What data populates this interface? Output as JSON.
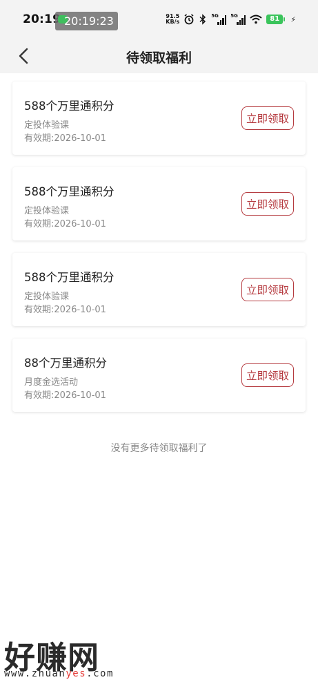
{
  "status_bar": {
    "time": "20:19",
    "overlay_time": "20:19:23",
    "net_speed_value": "91.5",
    "net_speed_unit": "KB/s",
    "signal1_label": "5G",
    "signal2_label": "5G",
    "battery_level": "81",
    "icons": [
      "alarm-icon",
      "bluetooth-icon",
      "signal-icon",
      "wifi-icon",
      "battery-icon",
      "charging-icon"
    ]
  },
  "header": {
    "back_icon": "chevron-left-icon",
    "title": "待领取福利"
  },
  "rewards": [
    {
      "title": "588个万里通积分",
      "desc": "定投体验课",
      "validity": "有效期:2026-10-01",
      "button": "立即领取"
    },
    {
      "title": "588个万里通积分",
      "desc": "定投体验课",
      "validity": "有效期:2026-10-01",
      "button": "立即领取"
    },
    {
      "title": "588个万里通积分",
      "desc": "定投体验课",
      "validity": "有效期:2026-10-01",
      "button": "立即领取"
    },
    {
      "title": "88个万里通积分",
      "desc": "月度金选活动",
      "validity": "有效期:2026-10-01",
      "button": "立即领取"
    }
  ],
  "footer_note": "没有更多待领取福利了",
  "watermark": {
    "text": "好赚网",
    "url_prefix": "www.zhuan",
    "url_highlight": "yes",
    "url_suffix": ".com"
  },
  "colors": {
    "accent": "#b53a3f",
    "header_bg": "#f3f3f3",
    "battery": "#3ac45b",
    "muted_text": "#888888"
  }
}
